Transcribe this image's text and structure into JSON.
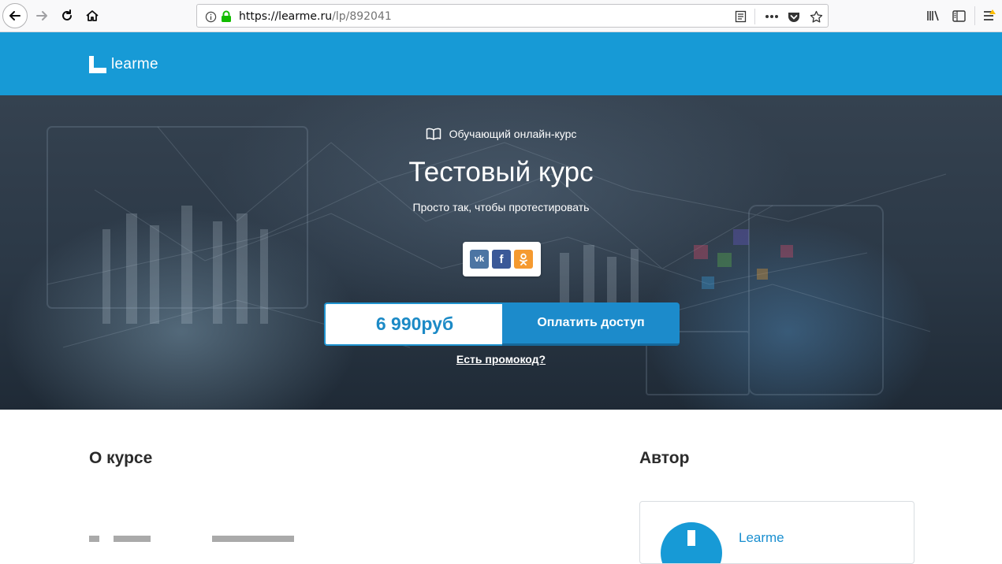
{
  "browser": {
    "url_scheme_host": "https://learme.ru",
    "url_path": "/lp/892041",
    "icons": {
      "back": "back-arrow-icon",
      "forward": "forward-arrow-icon",
      "reload": "reload-icon",
      "home": "home-icon",
      "info": "info-icon",
      "lock": "lock-icon",
      "reader": "reader-view-icon",
      "more": "more-dots-icon",
      "pocket": "pocket-icon",
      "bookmark": "star-icon",
      "library": "library-icon",
      "sidebar": "sidebar-icon",
      "menu": "hamburger-menu-icon"
    }
  },
  "site": {
    "logo_text": "learme",
    "brand_color": "#179ad6"
  },
  "hero": {
    "subtitle": "Обучающий онлайн-курс",
    "title": "Тестовый курс",
    "description": "Просто так, чтобы протестировать",
    "share": {
      "vk": "vk",
      "fb": "f",
      "ok": "ok-icon"
    },
    "price": "6 990руб",
    "pay_label": "Оплатить доступ",
    "promo_label": "Есть промокод?"
  },
  "content": {
    "about_title": "О курсе",
    "author_title": "Автор",
    "author_name": "Learme"
  }
}
